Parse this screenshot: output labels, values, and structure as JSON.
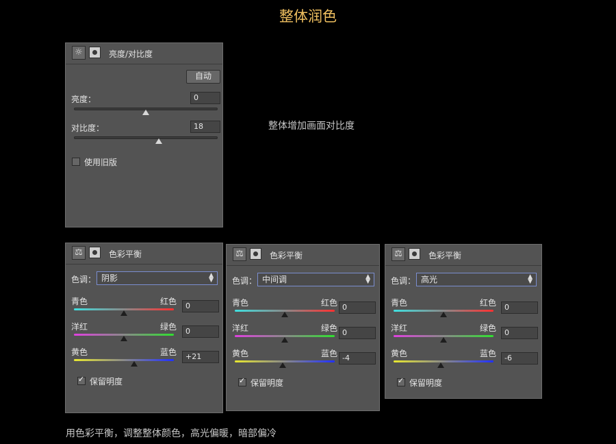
{
  "title": "整体润色",
  "brightness_caption": "整体增加画面对比度",
  "bottom_caption": "用色彩平衡，调整整体颜色，高光偏暖，暗部偏冷",
  "icons": {
    "brightness": "sun-icon",
    "balance": "scale-icon",
    "mask": "layer-mask-icon",
    "dropdown": "updown-arrows-icon"
  },
  "colors": {
    "title": "#f0c060",
    "panel_bg": "#535353",
    "accent": "#7b8ed0"
  },
  "brightness_panel": {
    "title": "亮度/对比度",
    "auto_label": "自动",
    "brightness_label": "亮度：",
    "brightness_value": "0",
    "brightness_pos": 0.5,
    "contrast_label": "对比度：",
    "contrast_value": "18",
    "contrast_pos": 0.59,
    "legacy_label": "使用旧版",
    "legacy_checked": false
  },
  "balance_panels": [
    {
      "title": "色彩平衡",
      "tone_label": "色调：",
      "tone_value": "阴影",
      "cyan": "青色",
      "red": "红色",
      "cyan_red": "0",
      "magenta": "洋红",
      "green": "绿色",
      "magenta_green": "0",
      "yellow": "黄色",
      "blue": "蓝色",
      "yellow_blue": "+21",
      "preserve_label": "保留明度",
      "preserve_checked": true
    },
    {
      "title": "色彩平衡",
      "tone_label": "色调：",
      "tone_value": "中间调",
      "cyan": "青色",
      "red": "红色",
      "cyan_red": "0",
      "magenta": "洋红",
      "green": "绿色",
      "magenta_green": "0",
      "yellow": "黄色",
      "blue": "蓝色",
      "yellow_blue": "-4",
      "preserve_label": "保留明度",
      "preserve_checked": true
    },
    {
      "title": "色彩平衡",
      "tone_label": "色调：",
      "tone_value": "高光",
      "cyan": "青色",
      "red": "红色",
      "cyan_red": "0",
      "magenta": "洋红",
      "green": "绿色",
      "magenta_green": "0",
      "yellow": "黄色",
      "blue": "蓝色",
      "yellow_blue": "-6",
      "preserve_label": "保留明度",
      "preserve_checked": true
    }
  ]
}
